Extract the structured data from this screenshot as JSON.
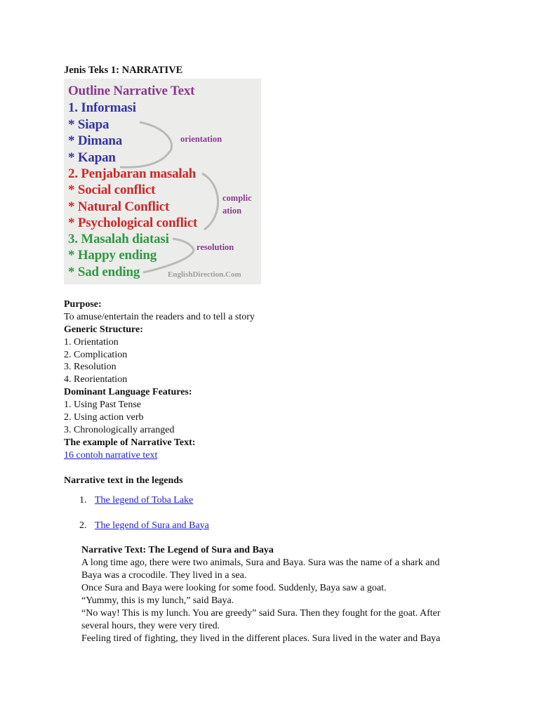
{
  "document": {
    "heading": "Jenis Teks 1: NARRATIVE",
    "outline_image": {
      "title": "Outline Narrative Text",
      "sections": [
        {
          "heading": "1. Informasi",
          "color": "#3535a5",
          "items": [
            "* Siapa",
            "* Dimana",
            "* Kapan"
          ],
          "label": "orientation"
        },
        {
          "heading": "2. Penjabaran masalah",
          "color": "#cf2526",
          "items": [
            "* Social conflict",
            "* Natural Conflict",
            "* Psychological conflict"
          ],
          "label_lines": [
            "complic",
            "ation"
          ]
        },
        {
          "heading": "3. Masalah diatasi",
          "color": "#2e9a43",
          "items": [
            "* Happy ending",
            "* Sad ending"
          ],
          "label": "resolution"
        }
      ],
      "watermark": "EnglishDirection.Com",
      "title_color": "#8a3a8e"
    },
    "purpose": {
      "label": "Purpose:",
      "text": "To amuse/entertain the readers and to tell a story"
    },
    "generic_structure": {
      "label": "Generic Structure:",
      "items": [
        "1. Orientation",
        "2. Complication",
        "3. Resolution",
        "4. Reorientation"
      ]
    },
    "language_features": {
      "label": "Dominant Language Features:",
      "items": [
        "1. Using Past Tense",
        "2. Using action verb",
        "3. Chronologically arranged"
      ]
    },
    "example": {
      "label": "The example of Narrative Text:",
      "link_text": "16 contoh narrative text "
    },
    "legends": {
      "heading": "Narrative text in the legends",
      "items": [
        {
          "num": "1.",
          "text": "The legend of Toba Lake"
        },
        {
          "num": "2.",
          "text": "The legend of Sura and Baya"
        }
      ]
    },
    "story": {
      "title": "Narrative Text: The Legend of Sura and Baya",
      "lines": [
        "A long time ago, there were two animals, Sura and Baya. Sura was the name of a shark and",
        "Baya was a crocodile. They lived in a sea.",
        "Once Sura and Baya were looking for some food. Suddenly, Baya saw a goat.",
        "“Yummy, this is my lunch,” said Baya.",
        "“No way! This is my lunch. You are greedy” said Sura. Then they fought for the goat. After",
        "several hours, they were very tired.",
        "Feeling tired of fighting, they lived in the different places. Sura lived in the water and Baya"
      ]
    },
    "link_color": "#1a1ae0"
  }
}
